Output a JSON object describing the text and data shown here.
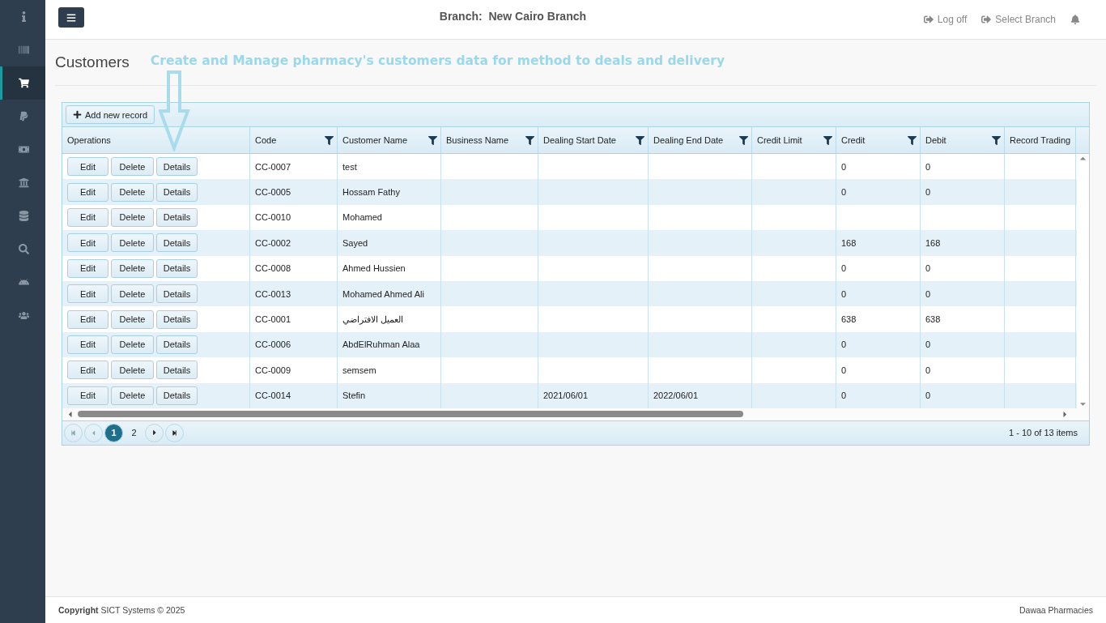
{
  "sidebar": {
    "items": [
      {
        "selected": false
      },
      {
        "selected": false
      },
      {
        "selected": true
      },
      {
        "selected": false
      },
      {
        "selected": false
      },
      {
        "selected": false
      },
      {
        "selected": false
      },
      {
        "selected": false
      },
      {
        "selected": false
      },
      {
        "selected": false
      }
    ]
  },
  "topbar": {
    "branch": "Branch:  New Cairo Branch",
    "links": [
      "Log off",
      "Select Branch"
    ]
  },
  "page": {
    "title": "Customers",
    "annotation": "Create and Manage pharmacy's customers data for method to deals and delivery"
  },
  "grid": {
    "toolbar_button": "Add new record",
    "columns": [
      {
        "label": "Operations",
        "filter": false
      },
      {
        "label": "Code",
        "filter": true
      },
      {
        "label": "Customer Name",
        "filter": true
      },
      {
        "label": "Business Name",
        "filter": true
      },
      {
        "label": "Dealing Start Date",
        "filter": true
      },
      {
        "label": "Dealing End Date",
        "filter": true
      },
      {
        "label": "Credit Limit",
        "filter": true
      },
      {
        "label": "Credit",
        "filter": true
      },
      {
        "label": "Debit",
        "filter": true
      },
      {
        "label": "Record Trading",
        "filter": false
      }
    ],
    "rows": [
      {
        "actions": [
          "Edit",
          "Delete",
          "Details"
        ],
        "code": "CC-0007",
        "customer_name": "test",
        "credit": "0",
        "debit": "0"
      },
      {
        "actions": [
          "Edit",
          "Delete",
          "Details"
        ],
        "code": "CC-0005",
        "customer_name": "Hossam Fathy",
        "credit": "0",
        "debit": "0"
      },
      {
        "actions": [
          "Edit",
          "Delete",
          "Details"
        ],
        "code": "CC-0010",
        "customer_name": "Mohamed"
      },
      {
        "actions": [
          "Edit",
          "Delete",
          "Details"
        ],
        "code": "CC-0002",
        "customer_name": "Sayed",
        "credit": "168",
        "debit": "168"
      },
      {
        "actions": [
          "Edit",
          "Delete",
          "Details"
        ],
        "code": "CC-0008",
        "customer_name": "Ahmed Hussien",
        "credit": "0",
        "debit": "0"
      },
      {
        "actions": [
          "Edit",
          "Delete",
          "Details"
        ],
        "code": "CC-0013",
        "customer_name": "Mohamed Ahmed Ali",
        "credit": "0",
        "debit": "0"
      },
      {
        "actions": [
          "Edit",
          "Delete",
          "Details"
        ],
        "code": "CC-0001",
        "customer_name": "العميل الافتراضي",
        "credit": "638",
        "debit": "638"
      },
      {
        "actions": [
          "Edit",
          "Delete",
          "Details"
        ],
        "code": "CC-0006",
        "customer_name": "AbdElRuhman Alaa",
        "credit": "0",
        "debit": "0"
      },
      {
        "actions": [
          "Edit",
          "Delete",
          "Details"
        ],
        "code": "CC-0009",
        "customer_name": "semsem",
        "credit": "0",
        "debit": "0"
      },
      {
        "actions": [
          "Edit",
          "Delete",
          "Details"
        ],
        "code": "CC-0014",
        "customer_name": "Stefin",
        "dealing_start_date": "2021/06/01",
        "dealing_end_date": "2022/06/01",
        "credit": "0",
        "debit": "0"
      }
    ],
    "pager": {
      "pages": [
        {
          "label": "1",
          "selected": true
        },
        {
          "label": "2",
          "selected": false
        }
      ],
      "info": "1 - 10 of 13 items"
    }
  },
  "footer": {
    "copyright": "**Copyright** SICT Systems © 2025",
    "brand": "Dawaa Pharmacies"
  }
}
